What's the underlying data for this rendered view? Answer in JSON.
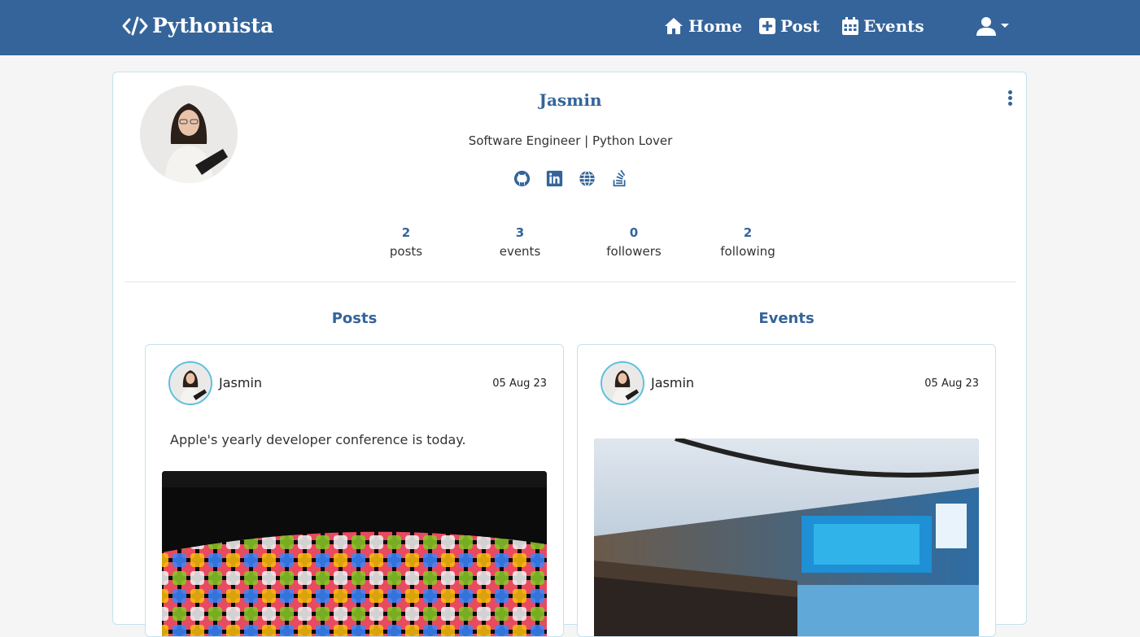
{
  "app": {
    "brand": "Pythonista"
  },
  "nav": {
    "home": "Home",
    "post": "Post",
    "events": "Events"
  },
  "profile": {
    "name": "Jasmin",
    "bio": "Software Engineer | Python Lover",
    "socials": [
      "github-icon",
      "linkedin-icon",
      "globe-icon",
      "stack-overflow-icon"
    ],
    "stats": [
      {
        "value": "2",
        "label": "posts"
      },
      {
        "value": "3",
        "label": "events"
      },
      {
        "value": "0",
        "label": "followers"
      },
      {
        "value": "2",
        "label": "following"
      }
    ]
  },
  "sections": {
    "posts": "Posts",
    "events": "Events"
  },
  "post": {
    "author": "Jasmin",
    "date": "05 Aug 23",
    "text": "Apple's yearly developer conference is today."
  },
  "event": {
    "author": "Jasmin",
    "date": "05 Aug 23"
  },
  "colors": {
    "primary": "#34649a",
    "accent": "#5bc0de",
    "border": "#c5e2ef"
  }
}
